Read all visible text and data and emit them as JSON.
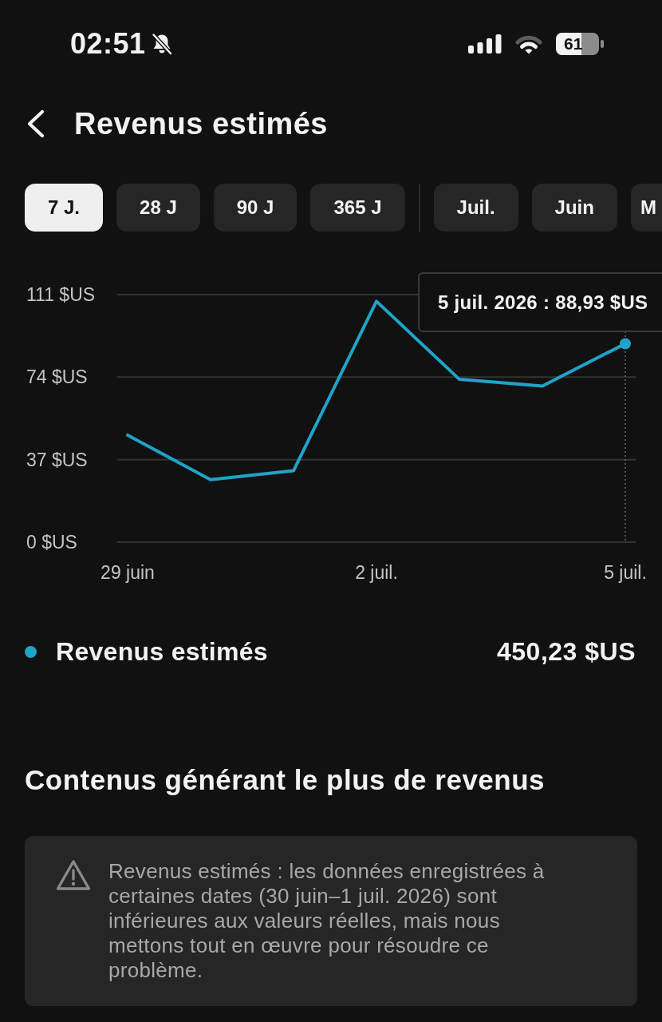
{
  "status_bar": {
    "time": "02:51",
    "silent": true,
    "battery": "61"
  },
  "header": {
    "title": "Revenus estimés"
  },
  "tabs": {
    "ranges": [
      {
        "label": "7 J.",
        "selected": true
      },
      {
        "label": "28 J",
        "selected": false
      },
      {
        "label": "90 J",
        "selected": false
      },
      {
        "label": "365 J",
        "selected": false
      }
    ],
    "months": [
      {
        "label": "Juil.",
        "selected": false
      },
      {
        "label": "Juin",
        "selected": false
      },
      {
        "label": "M",
        "selected": false
      }
    ]
  },
  "chart": {
    "chart_data": {
      "type": "line",
      "categories": [
        "29 juin",
        null,
        null,
        "2 juil.",
        null,
        null,
        "5 juil."
      ],
      "ylim": [
        0,
        111
      ],
      "yticks": [
        {
          "value": 0,
          "label": "0 $US"
        },
        {
          "value": 37,
          "label": "37 $US"
        },
        {
          "value": 74,
          "label": "74 $US"
        },
        {
          "value": 111,
          "label": "111 $US"
        }
      ],
      "series": [
        {
          "name": "Revenus estimés",
          "color": "#1fa3c9",
          "values": [
            48,
            28,
            32,
            108,
            73,
            70,
            89
          ]
        }
      ],
      "annotations": [
        "5 juil. 2026 : 88,93 $US"
      ]
    },
    "total": "450,23 $US"
  },
  "section": {
    "title": "Contenus générant le plus de revenus"
  },
  "notice": {
    "kind": "warning",
    "text": "Revenus estimés : les données enregistrées à certaines dates (30 juin–1 juil. 2026) sont inférieures aux valeurs réelles, mais nous mettons tout en œuvre pour résoudre ce problème."
  }
}
